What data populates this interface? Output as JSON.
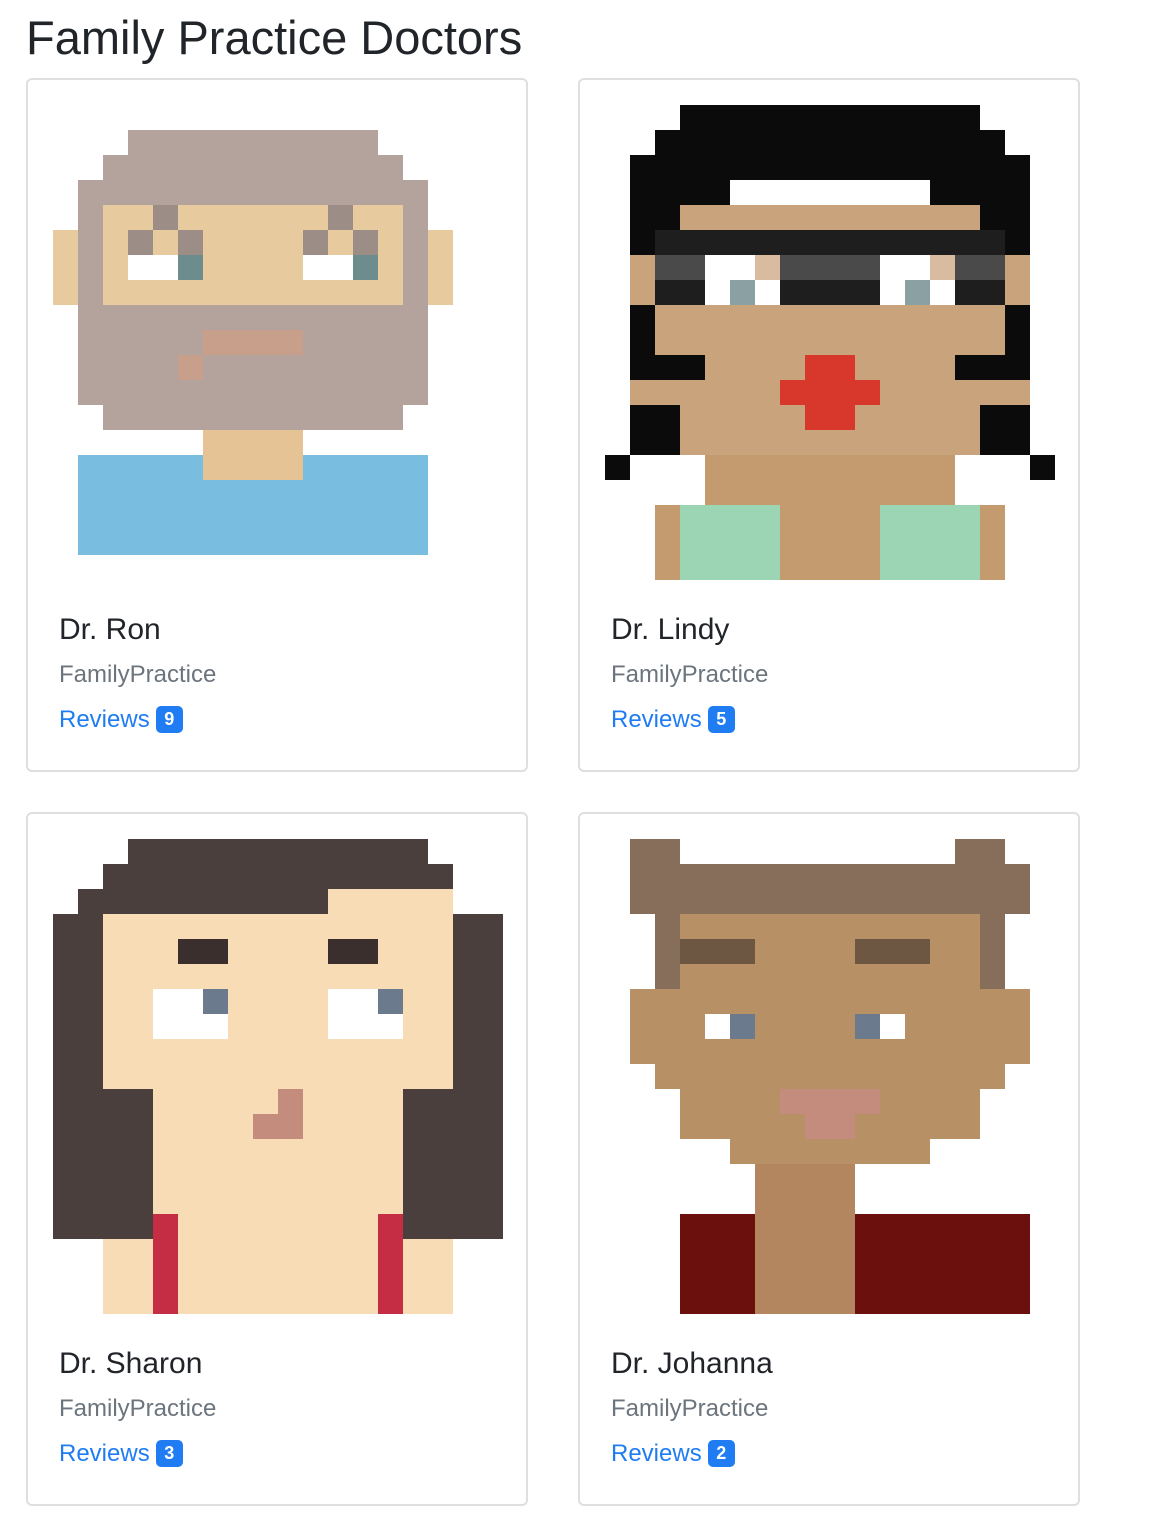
{
  "page": {
    "title": "Family Practice Doctors"
  },
  "doctors": [
    {
      "name": "Dr. Ron",
      "specialty": "FamilyPractice",
      "reviews_label": "Reviews",
      "review_count": "9",
      "avatar_icon": "pixel-avatar-bearded-man"
    },
    {
      "name": "Dr. Lindy",
      "specialty": "FamilyPractice",
      "reviews_label": "Reviews",
      "review_count": "5",
      "avatar_icon": "pixel-avatar-woman-glasses"
    },
    {
      "name": "Dr. Sharon",
      "specialty": "FamilyPractice",
      "reviews_label": "Reviews",
      "review_count": "3",
      "avatar_icon": "pixel-avatar-woman-long-hair"
    },
    {
      "name": "Dr. Johanna",
      "specialty": "FamilyPractice",
      "reviews_label": "Reviews",
      "review_count": "2",
      "avatar_icon": "pixel-avatar-woman-short-hair"
    }
  ],
  "colors": {
    "link": "#1f7cf2",
    "badge": "#1f7cf2",
    "muted": "#6c757d",
    "border": "#dfdfdf"
  }
}
